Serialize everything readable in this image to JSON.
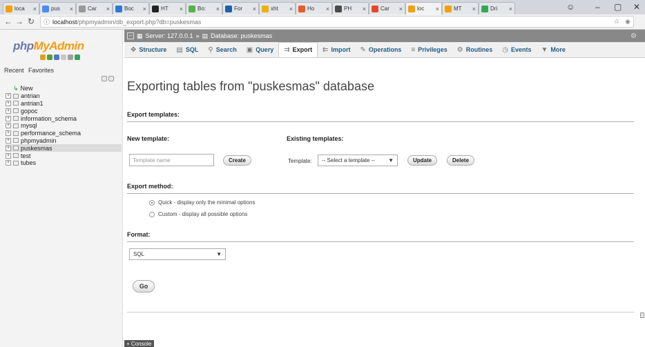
{
  "browser": {
    "tabs": [
      {
        "label": "loca",
        "color": "#f4a000"
      },
      {
        "label": "pus",
        "color": "#4a8af4"
      },
      {
        "label": "Car",
        "color": "#999999"
      },
      {
        "label": "Boc",
        "color": "#2e7bd6"
      },
      {
        "label": "HT",
        "color": "#222222"
      },
      {
        "label": "Bo:",
        "color": "#59b34a"
      },
      {
        "label": "For",
        "color": "#1f5fa8"
      },
      {
        "label": "xht",
        "color": "#f0b000"
      },
      {
        "label": "Ho",
        "color": "#e85a2a"
      },
      {
        "label": "PH",
        "color": "#4a4a4a"
      },
      {
        "label": "Car",
        "color": "#e8462a"
      },
      {
        "label": "loc",
        "color": "#f4a000",
        "active": true
      },
      {
        "label": "MT",
        "color": "#f4a000"
      },
      {
        "label": "Dri",
        "color": "#34a853"
      }
    ],
    "close_glyph": "×",
    "url_host": "localhost",
    "url_path": "/phpmyadmin/db_export.php?db=puskesmas"
  },
  "sidebar": {
    "logo_php": "php",
    "logo_myadmin": "MyAdmin",
    "recent": "Recent",
    "favorites": "Favorites",
    "databases": [
      {
        "name": "New",
        "kind": "new"
      },
      {
        "name": "antrian"
      },
      {
        "name": "antrian1"
      },
      {
        "name": "gopoc"
      },
      {
        "name": "information_schema"
      },
      {
        "name": "mysql"
      },
      {
        "name": "performance_schema"
      },
      {
        "name": "phpmyadmin"
      },
      {
        "name": "puskesmas",
        "active": true
      },
      {
        "name": "test"
      },
      {
        "name": "tubes"
      }
    ]
  },
  "breadcrumb": {
    "server": "Server: 127.0.0.1",
    "sep": "»",
    "database": "Database: puskesmas"
  },
  "menu": [
    {
      "label": "Structure",
      "icon": "✥",
      "name": "structure"
    },
    {
      "label": "SQL",
      "icon": "▤",
      "name": "sql"
    },
    {
      "label": "Search",
      "icon": "⚲",
      "name": "search"
    },
    {
      "label": "Query",
      "icon": "▣",
      "name": "query"
    },
    {
      "label": "Export",
      "icon": "⇉",
      "name": "export",
      "active": true
    },
    {
      "label": "Import",
      "icon": "⇇",
      "name": "import"
    },
    {
      "label": "Operations",
      "icon": "✎",
      "name": "operations"
    },
    {
      "label": "Privileges",
      "icon": "≡",
      "name": "privileges"
    },
    {
      "label": "Routines",
      "icon": "⚙",
      "name": "routines"
    },
    {
      "label": "Events",
      "icon": "◷",
      "name": "events"
    },
    {
      "label": "More",
      "icon": "▼",
      "name": "more"
    }
  ],
  "page": {
    "title": "Exporting tables from \"puskesmas\" database",
    "export_templates": "Export templates:",
    "new_template": "New template:",
    "existing_templates": "Existing templates:",
    "template_placeholder": "Template name",
    "create": "Create",
    "template_label": "Template:",
    "select_template": "-- Select a template --",
    "update": "Update",
    "delete": "Delete",
    "export_method": "Export method:",
    "method_quick": "Quick - display only the minimal options",
    "method_custom": "Custom - display all possible options",
    "format": "Format:",
    "format_value": "SQL",
    "go": "Go",
    "console": "Console"
  }
}
